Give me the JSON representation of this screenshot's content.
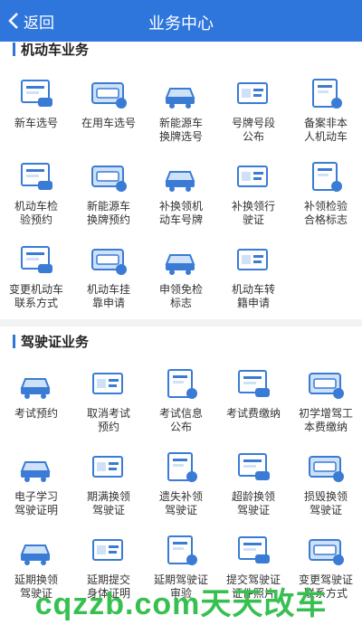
{
  "header": {
    "back_label": "返回",
    "title": "业务中心"
  },
  "colors": {
    "accent": "#2f76dc",
    "icon_blue": "#3a7bd5",
    "icon_light": "#cfe1f7",
    "watermark": "#37c050"
  },
  "sections": [
    {
      "title": "机动车业务",
      "items": [
        {
          "label": "新车选号",
          "icon": "new-car-plate-icon"
        },
        {
          "label": "在用车选号",
          "icon": "used-car-plate-icon"
        },
        {
          "label": "新能源车\n换牌选号",
          "icon": "ev-plate-icon"
        },
        {
          "label": "号牌号段\n公布",
          "icon": "plate-range-icon"
        },
        {
          "label": "备案非本\n人机动车",
          "icon": "registration-icon"
        },
        {
          "label": "机动车检\n验预约",
          "icon": "inspection-booking-icon"
        },
        {
          "label": "新能源车\n换牌预约",
          "icon": "ev-booking-icon"
        },
        {
          "label": "补换领机\n动车号牌",
          "icon": "replace-plate-icon"
        },
        {
          "label": "补换领行\n驶证",
          "icon": "replace-license-icon"
        },
        {
          "label": "补领检验\n合格标志",
          "icon": "inspection-mark-icon"
        },
        {
          "label": "变更机动车\n联系方式",
          "icon": "contact-change-icon"
        },
        {
          "label": "机动车挂\n靠申请",
          "icon": "affiliation-icon"
        },
        {
          "label": "申领免检\n标志",
          "icon": "exempt-mark-icon"
        },
        {
          "label": "机动车转\n籍申请",
          "icon": "transfer-icon"
        }
      ]
    },
    {
      "title": "驾驶证业务",
      "items": [
        {
          "label": "考试预约",
          "icon": "exam-booking-icon"
        },
        {
          "label": "取消考试\n预约",
          "icon": "cancel-exam-icon"
        },
        {
          "label": "考试信息\n公布",
          "icon": "exam-info-icon"
        },
        {
          "label": "考试费缴纳",
          "icon": "exam-fee-icon"
        },
        {
          "label": "初学增驾工\n本费缴纳",
          "icon": "fee-payment-icon"
        },
        {
          "label": "电子学习\n驾驶证明",
          "icon": "e-learning-cert-icon"
        },
        {
          "label": "期满换领\n驾驶证",
          "icon": "expiry-renew-icon"
        },
        {
          "label": "遗失补领\n驾驶证",
          "icon": "lost-replace-icon"
        },
        {
          "label": "超龄换领\n驾驶证",
          "icon": "overage-renew-icon"
        },
        {
          "label": "损毁换领\n驾驶证",
          "icon": "damaged-replace-icon"
        },
        {
          "label": "延期换领\n驾驶证",
          "icon": "delay-renew-icon"
        },
        {
          "label": "延期提交\n身体证明",
          "icon": "delay-health-icon"
        },
        {
          "label": "延期驾驶证\n审验",
          "icon": "delay-review-icon"
        },
        {
          "label": "提交驾驶证\n证件照片",
          "icon": "submit-photo-icon"
        },
        {
          "label": "变更驾驶证\n联系方式",
          "icon": "license-contact-icon"
        }
      ]
    }
  ],
  "watermark": "cqzzb.com天天改车"
}
